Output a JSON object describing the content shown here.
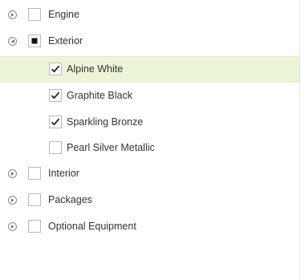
{
  "tree": {
    "nodes": [
      {
        "id": "engine",
        "label": "Engine",
        "level": 0,
        "expanded": false,
        "check_state": "unchecked",
        "selected": false,
        "expander_icon": "chevron-right-icon"
      },
      {
        "id": "exterior",
        "label": "Exterior",
        "level": 0,
        "expanded": true,
        "check_state": "partial",
        "selected": false,
        "expander_icon": "chevron-down-icon"
      },
      {
        "id": "alpine-white",
        "label": "Alpine White",
        "level": 1,
        "check_state": "checked",
        "selected": true
      },
      {
        "id": "graphite-black",
        "label": "Graphite Black",
        "level": 1,
        "check_state": "checked",
        "selected": false
      },
      {
        "id": "sparkling-bronze",
        "label": "Sparkling Bronze",
        "level": 1,
        "check_state": "checked",
        "selected": false
      },
      {
        "id": "pearl-silver-metallic",
        "label": "Pearl Silver Metallic",
        "level": 1,
        "check_state": "unchecked",
        "selected": false
      },
      {
        "id": "interior",
        "label": "Interior",
        "level": 0,
        "expanded": false,
        "check_state": "unchecked",
        "selected": false,
        "expander_icon": "chevron-right-icon"
      },
      {
        "id": "packages",
        "label": "Packages",
        "level": 0,
        "expanded": false,
        "check_state": "unchecked",
        "selected": false,
        "expander_icon": "chevron-right-icon"
      },
      {
        "id": "optional-equipment",
        "label": "Optional Equipment",
        "level": 0,
        "expanded": false,
        "check_state": "unchecked",
        "selected": false,
        "expander_icon": "chevron-right-icon"
      }
    ]
  },
  "colors": {
    "selection_background": "#ecf5d8",
    "text": "#333333",
    "checkbox_border": "#b9b9b9",
    "check_mark": "#222222"
  }
}
